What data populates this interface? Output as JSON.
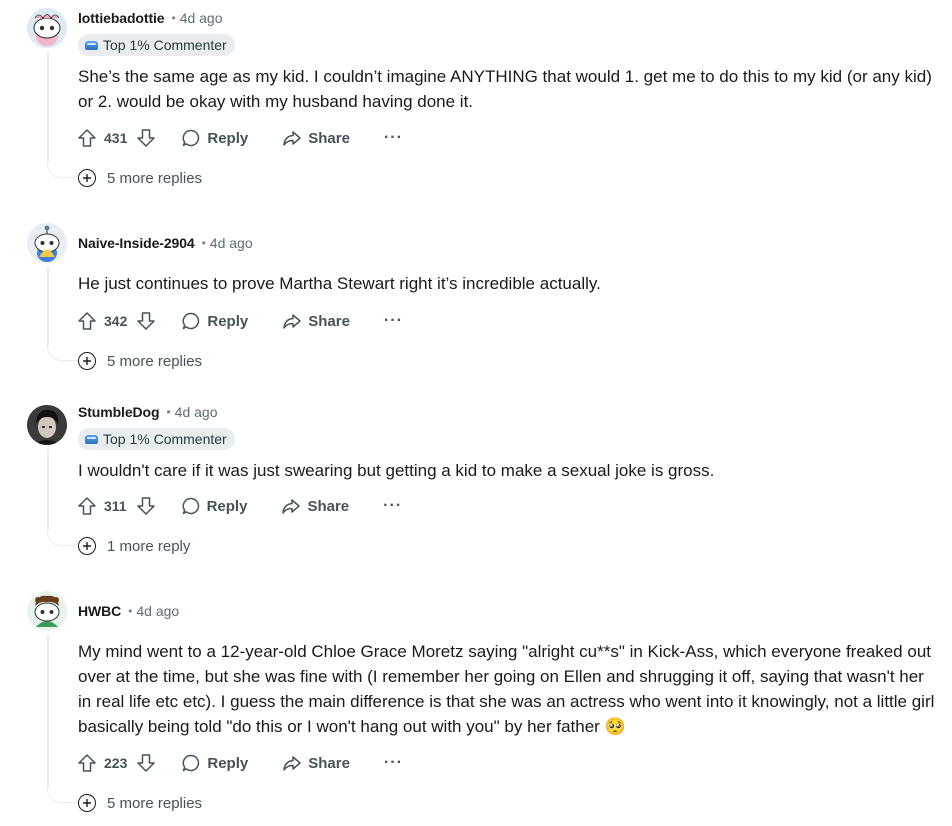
{
  "comments": [
    {
      "username": "lottiebadottie",
      "time": "4d ago",
      "flair": "Top 1% Commenter",
      "body": "She’s the same age as my kid. I couldn’t imagine ANYTHING that would 1. get me to do this to my kid (or any kid) or 2. would be okay with my husband having done it.",
      "score": "431",
      "reply_label": "Reply",
      "share_label": "Share",
      "more_label": "···",
      "more_replies": "5 more replies"
    },
    {
      "username": "Naive-Inside-2904",
      "time": "4d ago",
      "flair": "",
      "body": "He just continues to prove Martha Stewart right it’s incredible actually.",
      "score": "342",
      "reply_label": "Reply",
      "share_label": "Share",
      "more_label": "···",
      "more_replies": "5 more replies"
    },
    {
      "username": "StumbleDog",
      "time": "4d ago",
      "flair": "Top 1% Commenter",
      "body": "I wouldn't care if it was just swearing but getting a kid to make a sexual joke is gross.",
      "score": "311",
      "reply_label": "Reply",
      "share_label": "Share",
      "more_label": "···",
      "more_replies": "1 more reply"
    },
    {
      "username": "HWBC",
      "time": "4d ago",
      "flair": "",
      "body": "My mind went to a 12-year-old Chloe Grace Moretz saying \"alright cu**s\" in Kick-Ass, which everyone freaked out over at the time, but she was fine with (I remember her going on Ellen and shrugging it off, saying that wasn't her in real life etc etc). I guess the main difference is that she was an actress who went into it knowingly, not a little girl basically being told \"do this or I won't hang out with you\" by her father 🥺",
      "score": "223",
      "reply_label": "Reply",
      "share_label": "Share",
      "more_label": "···",
      "more_replies": "5 more replies"
    }
  ],
  "icons": {
    "upvote": "upvote-arrow-icon",
    "downvote": "downvote-arrow-icon",
    "reply": "speech-bubble-icon",
    "share": "share-arrow-icon",
    "expand": "plus-circle-icon"
  },
  "colors": {
    "text": "#1a1a1b",
    "meta": "#5c6c74",
    "flair_bg": "#eaedef",
    "thread_line": "#e5ebee"
  }
}
